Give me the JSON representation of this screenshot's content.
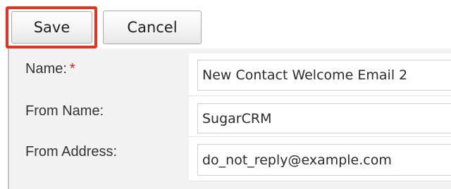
{
  "toolbar": {
    "save_label": "Save",
    "cancel_label": "Cancel",
    "highlight_color": "#e8321e"
  },
  "form": {
    "fields": [
      {
        "label": "Name:",
        "required_marker": "*",
        "value": "New Contact Welcome Email 2"
      },
      {
        "label": "From Name:",
        "value": "SugarCRM"
      },
      {
        "label": "From Address:",
        "value": "do_not_reply@example.com"
      }
    ]
  }
}
